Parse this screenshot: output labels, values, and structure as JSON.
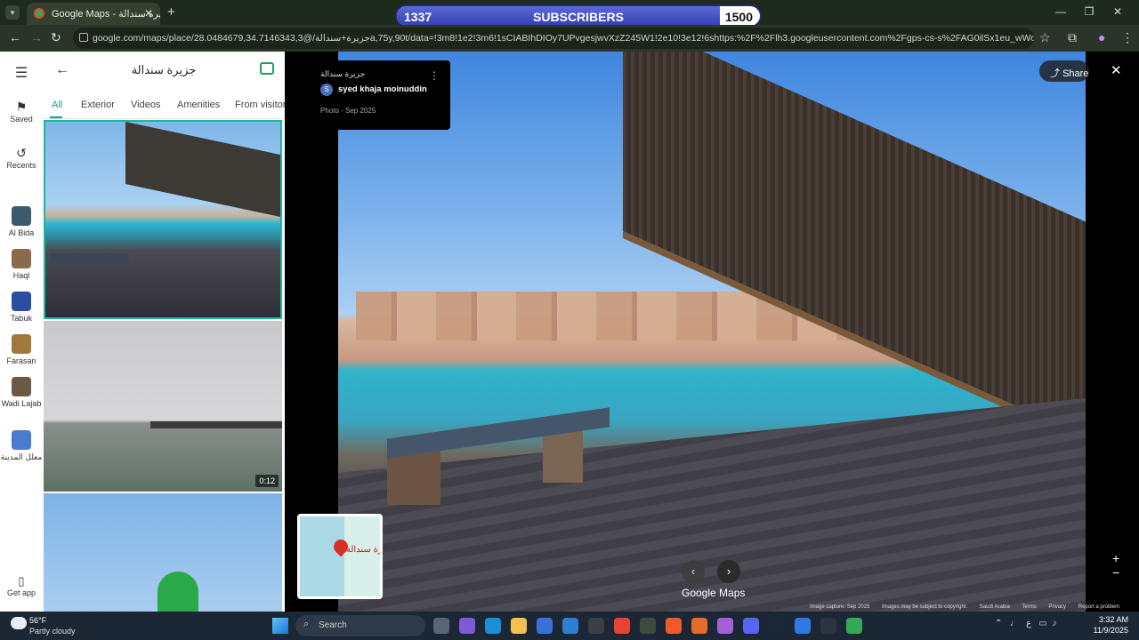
{
  "browser": {
    "tab_title": "Google Maps - جزيرة سندالة",
    "url": "google.com/maps/place/جزيرة+سندالة/@28.0484679,34.7146343,3a,75y,90t/data=!3m8!1e2!3m6!1sCIABIhDIOy7UPvgesjwvXzZ245W1!2e10!3e12!6shttps:%2F%2Flh3.googleusercontent.com%2Fgps-cs-s%2FAG0ilSx1eu_wWoGF-VUagMBt..."
  },
  "overlay": {
    "current": "1337",
    "label": "SUBSCRIBERS",
    "goal": "1500",
    "progress": 0.89
  },
  "rail": {
    "saved": "Saved",
    "recents": "Recents",
    "places": [
      {
        "label": "Al Bida"
      },
      {
        "label": "Haql"
      },
      {
        "label": "Tabuk"
      },
      {
        "label": "Farasan"
      },
      {
        "label": "Wadi Lajab"
      },
      {
        "label": "معلل المدينة"
      }
    ],
    "get_app": "Get app"
  },
  "panel": {
    "title": "جزيرة سندالة",
    "tabs": [
      "All",
      "Exterior",
      "Videos",
      "Amenities",
      "From visitors"
    ],
    "video_duration": "0:12"
  },
  "viewer": {
    "place": "جزيرة سندالة",
    "user_initial": "S",
    "user": "syed khaja moinuddin",
    "date": "Photo - Sep 2025",
    "share": "Share",
    "map_label": "جزيرة سندالة",
    "logo": "Google Maps",
    "attribution": [
      "Image capture: Sep 2025",
      "Images may be subject to copyright.",
      "Saudi Arabia",
      "Terms",
      "Privacy",
      "Report a problem"
    ]
  },
  "taskbar": {
    "temp": "56°F",
    "weather": "Partly cloudy",
    "search": "Search",
    "lang": "ع",
    "time": "3:32 AM",
    "date": "11/9/2025"
  }
}
